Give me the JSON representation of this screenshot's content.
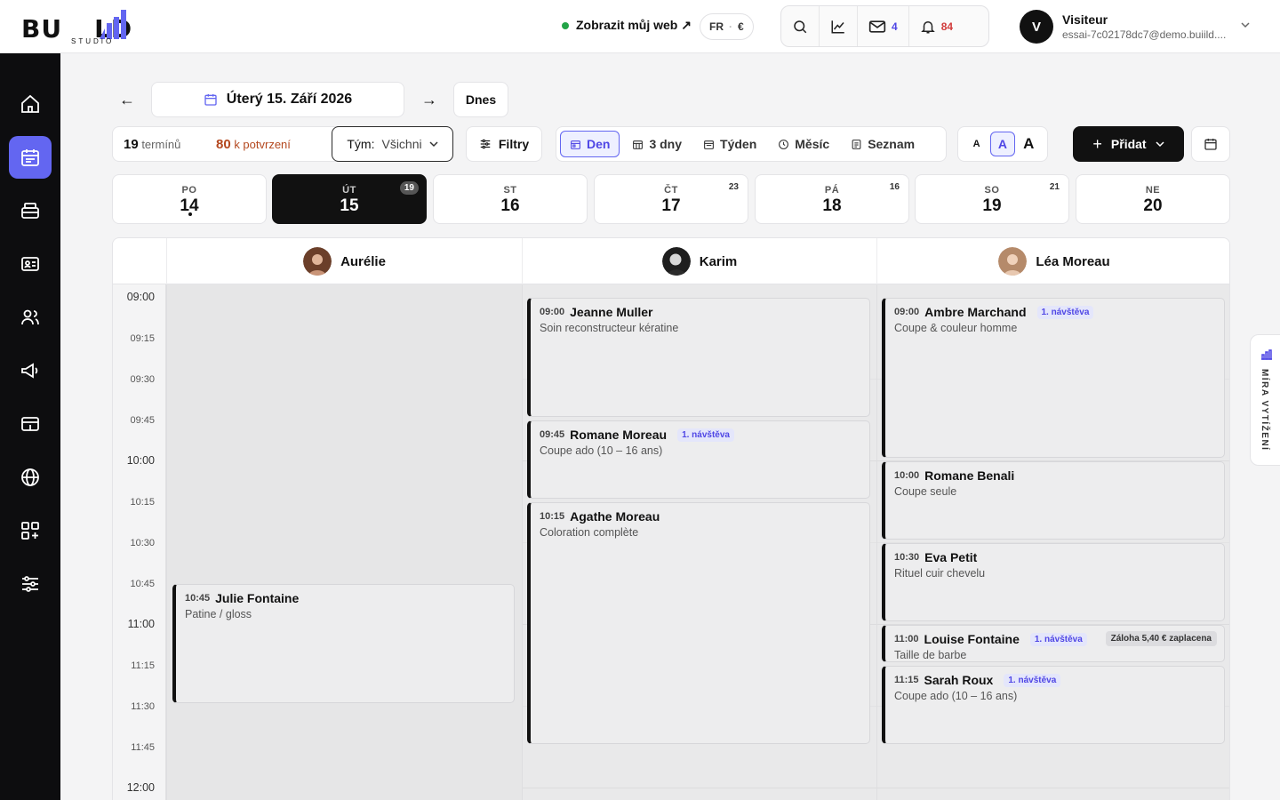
{
  "brand": {
    "logo_left": "BU",
    "logo_right": "LD",
    "logo_sub": "STUDIO"
  },
  "header": {
    "web_link": "Zobrazit můj web ↗",
    "lang": "FR",
    "currency": "€",
    "mail_count": "4",
    "notif_count": "84",
    "user_initial": "V",
    "user_name": "Visiteur",
    "user_email": "essai-7c02178dc7@demo.buiild...."
  },
  "sidebar": {
    "items": [
      {
        "icon": "home-icon"
      },
      {
        "icon": "calendar-icon",
        "active": true
      },
      {
        "icon": "register-icon"
      },
      {
        "icon": "id-card-icon"
      },
      {
        "icon": "users-icon"
      },
      {
        "icon": "megaphone-icon"
      },
      {
        "icon": "payment-icon"
      },
      {
        "icon": "globe-icon"
      },
      {
        "icon": "apps-icon"
      },
      {
        "icon": "sliders-icon"
      }
    ]
  },
  "datenav": {
    "prev": "←",
    "next": "→",
    "date": "Úterý 15. Září 2026",
    "today": "Dnes"
  },
  "toolbar": {
    "appt_count": "19",
    "appt_label": "termínů",
    "confirm_count": "80",
    "confirm_label": "k potvrzení",
    "team_label": "Tým:",
    "team_value": "Všichni",
    "filters": "Filtry",
    "views": [
      "Den",
      "3 dny",
      "Týden",
      "Měsíc",
      "Seznam"
    ],
    "font_sizes": [
      "A",
      "A",
      "A"
    ],
    "add": "Přidat"
  },
  "days": [
    {
      "name": "PO",
      "num": "14",
      "badge": ""
    },
    {
      "name": "ÚT",
      "num": "15",
      "badge": "19"
    },
    {
      "name": "ST",
      "num": "16",
      "badge": ""
    },
    {
      "name": "ČT",
      "num": "17",
      "badge": "23"
    },
    {
      "name": "PÁ",
      "num": "18",
      "badge": "16"
    },
    {
      "name": "SO",
      "num": "19",
      "badge": "21"
    },
    {
      "name": "NE",
      "num": "20",
      "badge": ""
    }
  ],
  "staff": [
    "Aurélie",
    "Karim",
    "Léa Moreau"
  ],
  "times": [
    "09:00",
    "09:15",
    "09:30",
    "09:45",
    "10:00",
    "10:15",
    "10:30",
    "10:45",
    "11:00",
    "11:15",
    "11:30",
    "11:45",
    "12:00"
  ],
  "appointments": [
    {
      "time": "10:45",
      "name": "Julie Fontaine",
      "service": "Patine / gloss",
      "tag": "",
      "deposit": ""
    },
    {
      "time": "09:00",
      "name": "Jeanne Muller",
      "service": "Soin reconstructeur kératine",
      "tag": "",
      "deposit": ""
    },
    {
      "time": "09:45",
      "name": "Romane Moreau",
      "service": "Coupe ado (10 – 16 ans)",
      "tag": "1. návštěva",
      "deposit": ""
    },
    {
      "time": "10:15",
      "name": "Agathe Moreau",
      "service": "Coloration complète",
      "tag": "",
      "deposit": ""
    },
    {
      "time": "09:00",
      "name": "Ambre Marchand",
      "service": "Coupe & couleur homme",
      "tag": "1. návštěva",
      "deposit": ""
    },
    {
      "time": "10:00",
      "name": "Romane Benali",
      "service": "Coupe seule",
      "tag": "",
      "deposit": ""
    },
    {
      "time": "10:30",
      "name": "Eva Petit",
      "service": "Rituel cuir chevelu",
      "tag": "",
      "deposit": ""
    },
    {
      "time": "11:00",
      "name": "Louise Fontaine",
      "service": "Taille de barbe",
      "tag": "1. návštěva",
      "deposit": "Záloha 5,40 € zaplacena"
    },
    {
      "time": "11:15",
      "name": "Sarah Roux",
      "service": "Coupe ado (10 – 16 ans)",
      "tag": "1. návštěva",
      "deposit": ""
    }
  ],
  "occupancy_tab": "MÍRA VYTÍŽENÍ",
  "colors": {
    "accent": "#6366f1",
    "dark": "#111111",
    "warn": "#b4481f"
  }
}
